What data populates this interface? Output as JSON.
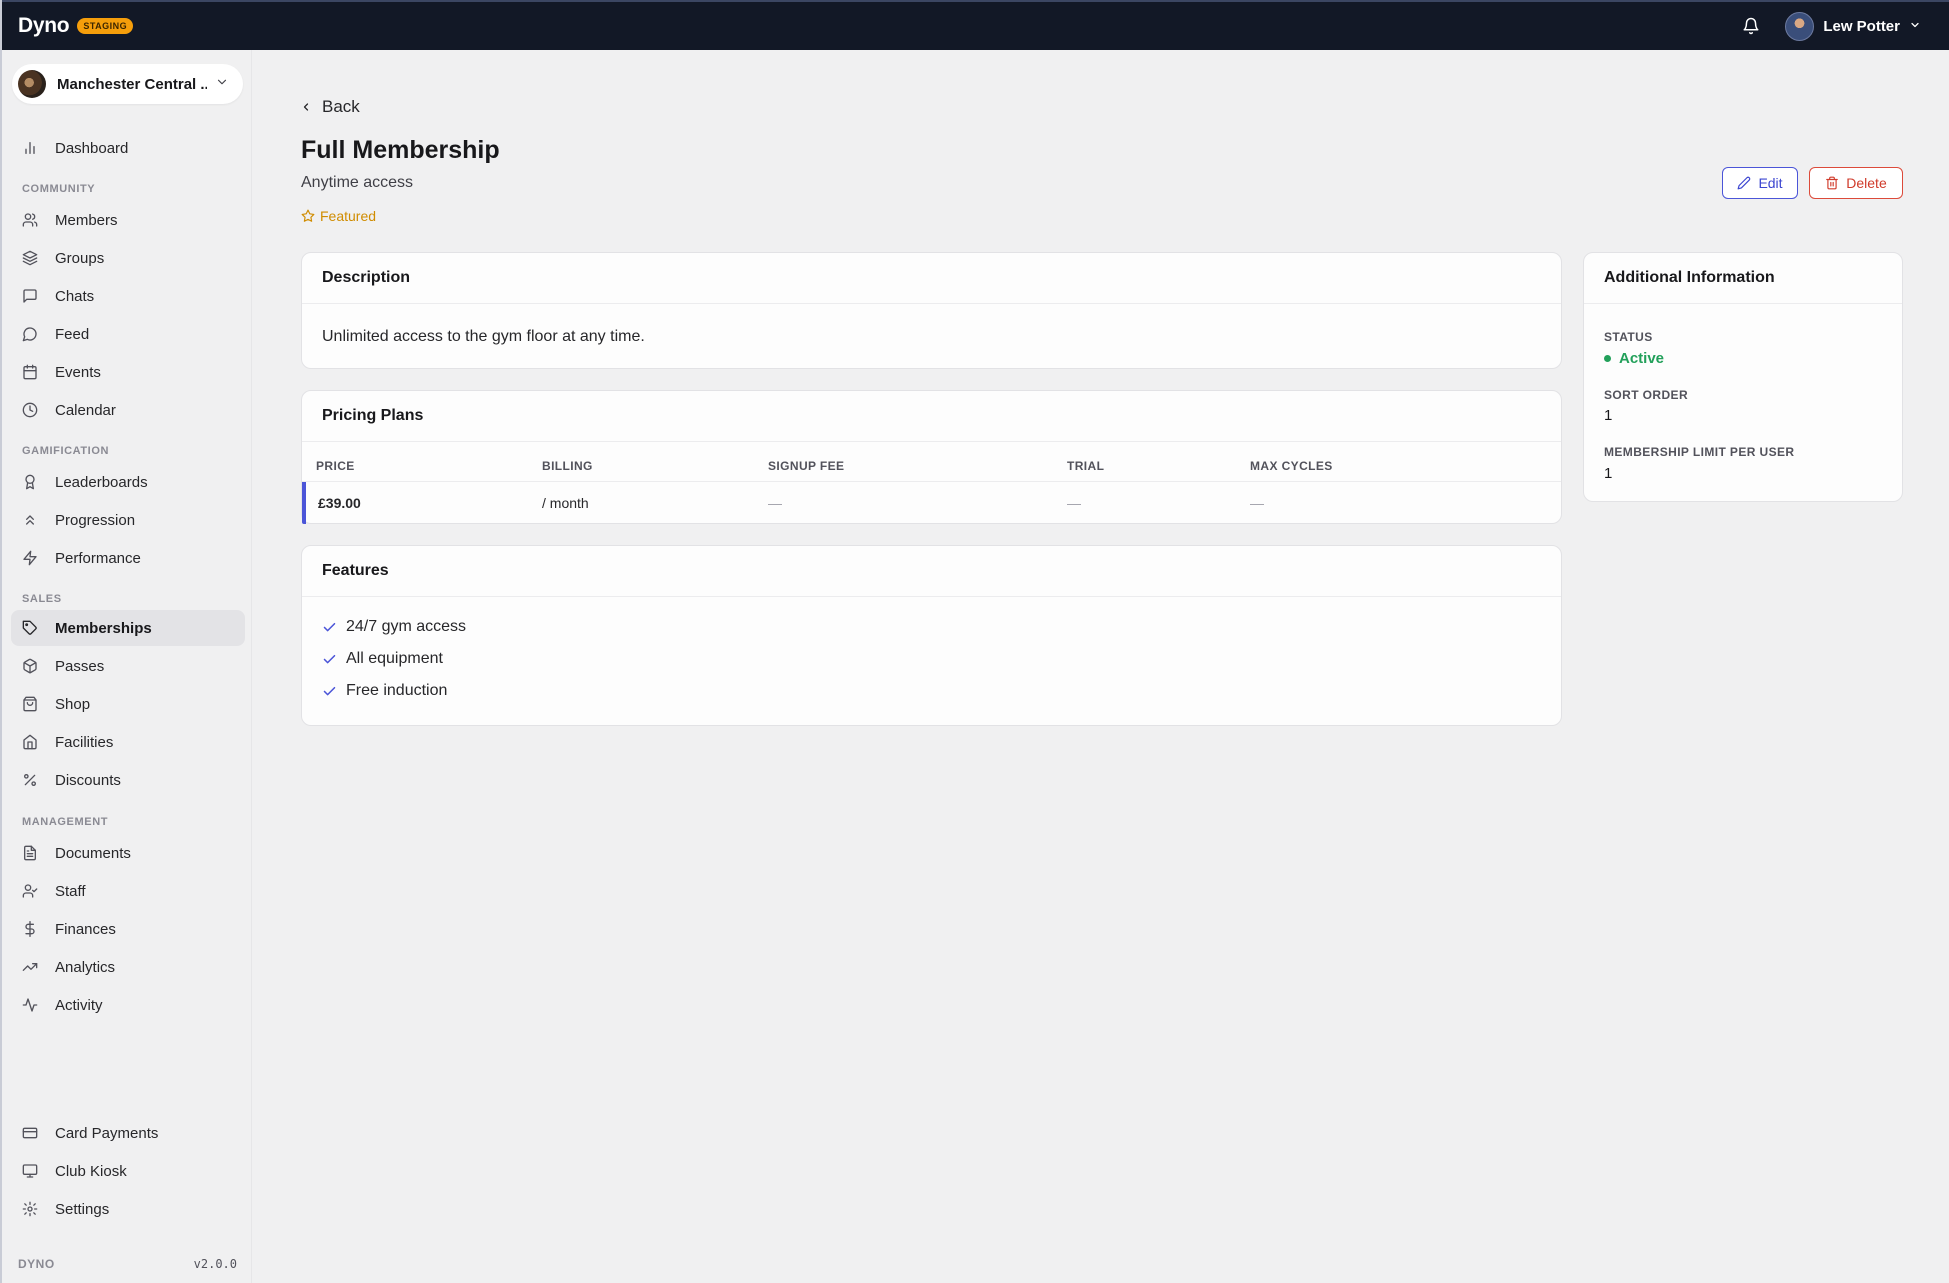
{
  "app": {
    "name": "Dyno",
    "env_badge": "STAGING"
  },
  "user": {
    "name": "Lew Potter"
  },
  "club": {
    "name": "Manchester Central ..."
  },
  "sidebar": {
    "dashboard": "Dashboard",
    "sections": {
      "community": "COMMUNITY",
      "gamification": "GAMIFICATION",
      "sales": "SALES",
      "management": "MANAGEMENT"
    },
    "community": [
      "Members",
      "Groups",
      "Chats",
      "Feed",
      "Events",
      "Calendar"
    ],
    "gamification": [
      "Leaderboards",
      "Progression",
      "Performance"
    ],
    "sales": [
      "Memberships",
      "Passes",
      "Shop",
      "Facilities",
      "Discounts"
    ],
    "management": [
      "Documents",
      "Staff",
      "Finances",
      "Analytics",
      "Activity"
    ],
    "bottom": [
      "Card Payments",
      "Club Kiosk",
      "Settings"
    ],
    "active": "Memberships",
    "footer_brand": "DYNO",
    "version": "v2.0.0"
  },
  "page": {
    "back_label": "Back",
    "title": "Full Membership",
    "subtitle": "Anytime access",
    "featured_label": "Featured",
    "edit_label": "Edit",
    "delete_label": "Delete"
  },
  "description": {
    "heading": "Description",
    "text": "Unlimited access to the gym floor at any time."
  },
  "pricing": {
    "heading": "Pricing Plans",
    "columns": [
      "PRICE",
      "BILLING",
      "SIGNUP FEE",
      "TRIAL",
      "MAX CYCLES"
    ],
    "rows": [
      {
        "price": "£39.00",
        "billing": "/ month",
        "signup_fee": "—",
        "trial": "—",
        "max_cycles": "—"
      }
    ]
  },
  "features": {
    "heading": "Features",
    "items": [
      "24/7 gym access",
      "All equipment",
      "Free induction"
    ]
  },
  "info": {
    "heading": "Additional Information",
    "status_label": "STATUS",
    "status_value": "Active",
    "sort_order_label": "SORT ORDER",
    "sort_order_value": "1",
    "limit_label": "MEMBERSHIP LIMIT PER USER",
    "limit_value": "1"
  },
  "colors": {
    "topbar": "#121826",
    "accent": "#4b55d8",
    "danger": "#dc4a3a",
    "featured": "#d08c00",
    "success": "#22a05a"
  }
}
